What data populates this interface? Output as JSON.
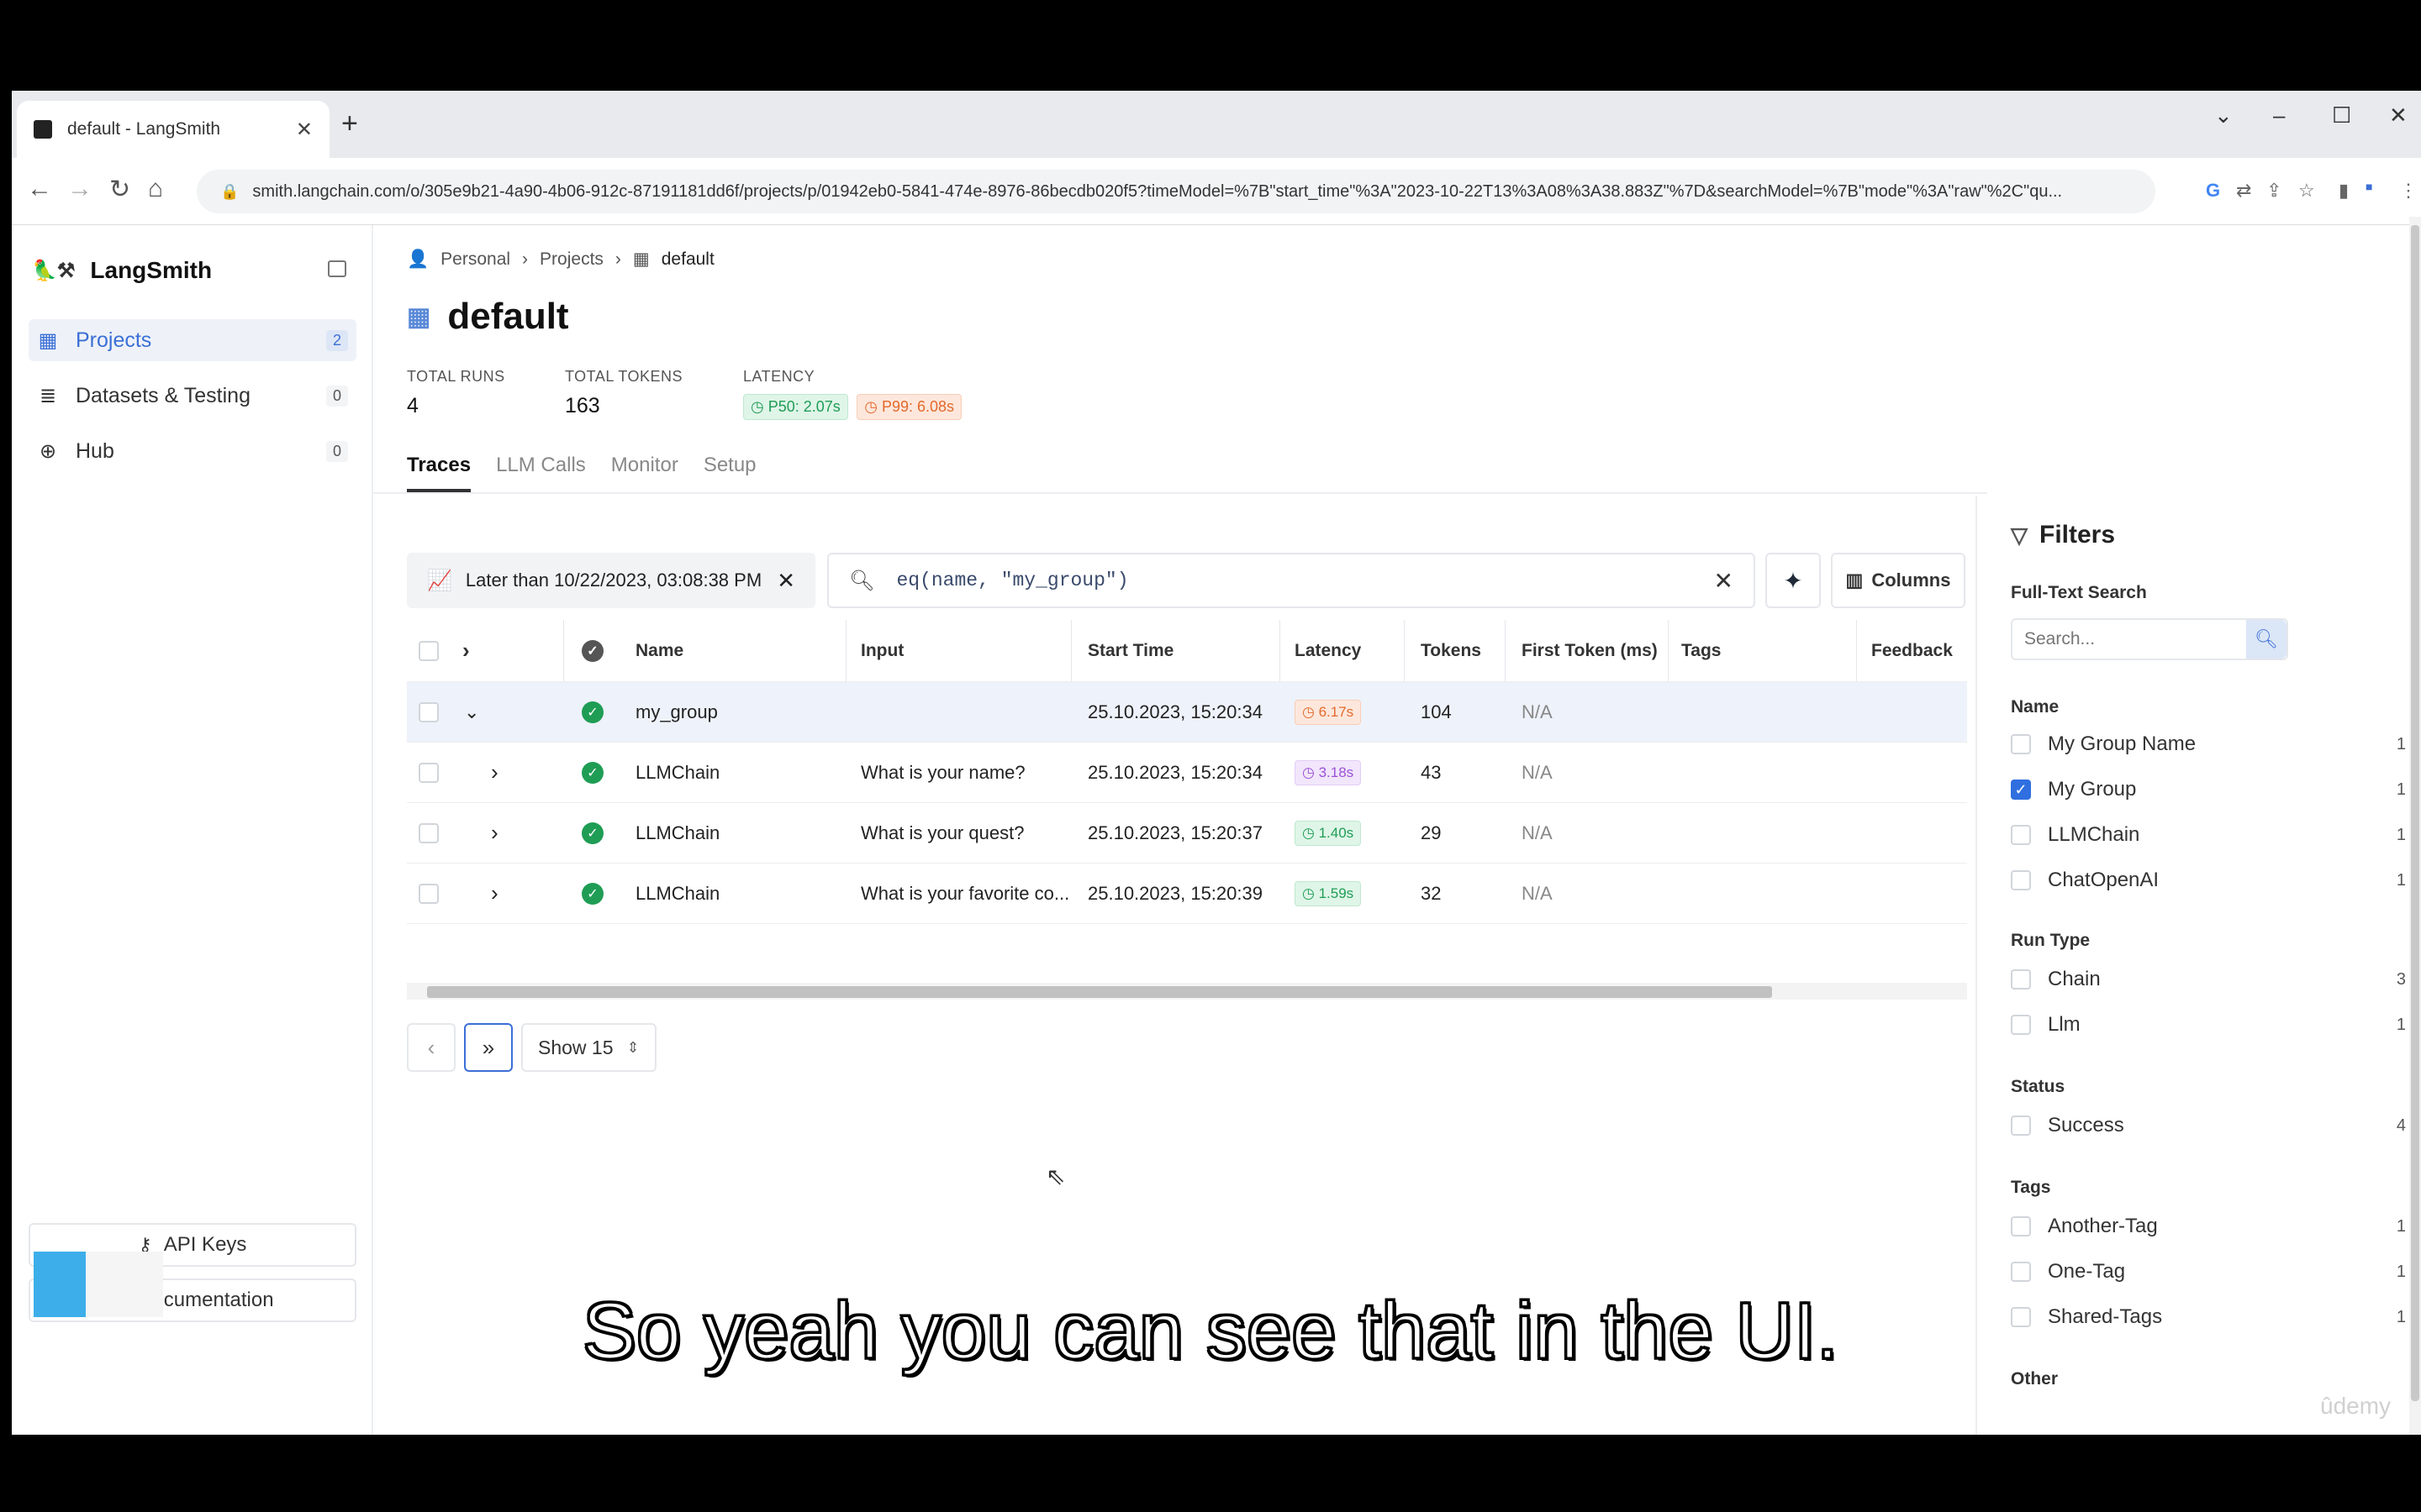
{
  "browser": {
    "tab_title": "default - LangSmith",
    "url": "smith.langchain.com/o/305e9b21-4a90-4b06-912c-87191181dd6f/projects/p/01942eb0-5841-474e-8976-86becdb020f5?timeModel=%7B\"start_time\"%3A\"2023-10-22T13%3A08%3A38.883Z\"%7D&searchModel=%7B\"mode\"%3A\"raw\"%2C\"qu..."
  },
  "sidebar": {
    "brand": "LangSmith",
    "items": [
      {
        "label": "Projects",
        "count": "2",
        "icon": "grid-icon"
      },
      {
        "label": "Datasets & Testing",
        "count": "0",
        "icon": "database-icon"
      },
      {
        "label": "Hub",
        "count": "0",
        "icon": "globe-icon"
      }
    ],
    "api_keys": "API Keys",
    "documentation": "Documentation"
  },
  "breadcrumb": [
    "Personal",
    "Projects",
    "default"
  ],
  "page_title": "default",
  "stats": {
    "total_runs_label": "TOTAL RUNS",
    "total_runs": "4",
    "total_tokens_label": "TOTAL TOKENS",
    "total_tokens": "163",
    "latency_label": "LATENCY",
    "p50": "P50: 2.07s",
    "p99": "P99: 6.08s"
  },
  "tabs": [
    "Traces",
    "LLM Calls",
    "Monitor",
    "Setup"
  ],
  "toolbar": {
    "time_filter": "Later than 10/22/2023, 03:08:38 PM",
    "search_query": "eq(name, \"my_group\")",
    "columns_label": "Columns"
  },
  "table": {
    "headers": [
      "Name",
      "Input",
      "Start Time",
      "Latency",
      "Tokens",
      "First Token (ms)",
      "Tags",
      "Feedback"
    ],
    "rows": [
      {
        "name": "my_group",
        "input": "",
        "start": "25.10.2023, 15:20:34",
        "latency": "6.17s",
        "tokens": "104",
        "first_token": "N/A"
      },
      {
        "name": "LLMChain",
        "input": "What is your name?",
        "start": "25.10.2023, 15:20:34",
        "latency": "3.18s",
        "tokens": "43",
        "first_token": "N/A"
      },
      {
        "name": "LLMChain",
        "input": "What is your quest?",
        "start": "25.10.2023, 15:20:37",
        "latency": "1.40s",
        "tokens": "29",
        "first_token": "N/A"
      },
      {
        "name": "LLMChain",
        "input": "What is your favorite co...",
        "start": "25.10.2023, 15:20:39",
        "latency": "1.59s",
        "tokens": "32",
        "first_token": "N/A"
      }
    ]
  },
  "pagination": {
    "show": "Show 15"
  },
  "filters": {
    "title": "Filters",
    "fulltext_label": "Full-Text Search",
    "search_placeholder": "Search...",
    "name_label": "Name",
    "name_options": [
      {
        "label": "My Group Name",
        "count": "1",
        "checked": false
      },
      {
        "label": "My Group",
        "count": "1",
        "checked": true
      },
      {
        "label": "LLMChain",
        "count": "1",
        "checked": false
      },
      {
        "label": "ChatOpenAI",
        "count": "1",
        "checked": false
      }
    ],
    "runtype_label": "Run Type",
    "runtype_options": [
      {
        "label": "Chain",
        "count": "3"
      },
      {
        "label": "Llm",
        "count": "1"
      }
    ],
    "status_label": "Status",
    "status_options": [
      {
        "label": "Success",
        "count": "4"
      }
    ],
    "tags_label": "Tags",
    "tags_options": [
      {
        "label": "Another-Tag",
        "count": "1"
      },
      {
        "label": "One-Tag",
        "count": "1"
      },
      {
        "label": "Shared-Tags",
        "count": "1"
      }
    ],
    "other_label": "Other"
  },
  "subtitle": "So yeah you can see that in the UI.",
  "watermark": "ûdemy"
}
